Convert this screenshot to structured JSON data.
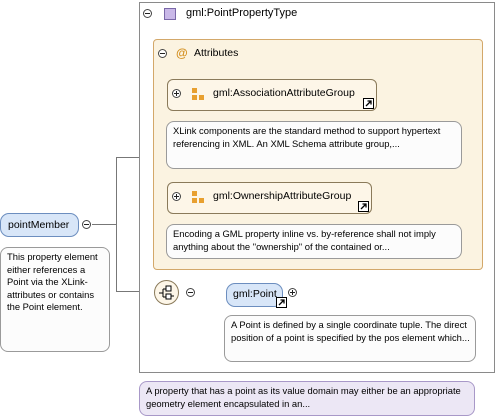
{
  "type_box": {
    "title": "gml:PointPropertyType"
  },
  "attributes": {
    "label": "Attributes",
    "groups": [
      {
        "name": "gml:AssociationAttributeGroup",
        "note": "XLink components are the standard method to support hypertext referencing in XML. An XML Schema attribute group,..."
      },
      {
        "name": "gml:OwnershipAttributeGroup",
        "note": "Encoding a GML property inline vs. by-reference shall not imply anything about the \"ownership\" of the contained or..."
      }
    ]
  },
  "point_member": {
    "label": "pointMember",
    "note": "This property element either references a Point via the XLink-attributes or contains the Point element."
  },
  "point": {
    "label": "gml:Point",
    "note": "A Point is defined by a single coordinate tuple. The direct position of a point is specified by the pos element which..."
  },
  "type_note": "A property that has a point as its value domain may either be an appropriate geometry element encapsulated in an...",
  "colors": {
    "element_fill": "#d8e6f8",
    "attribute_fill": "#fbf3e1",
    "group_fill": "#fdf6e8",
    "type_note_fill": "#ece7f5"
  }
}
